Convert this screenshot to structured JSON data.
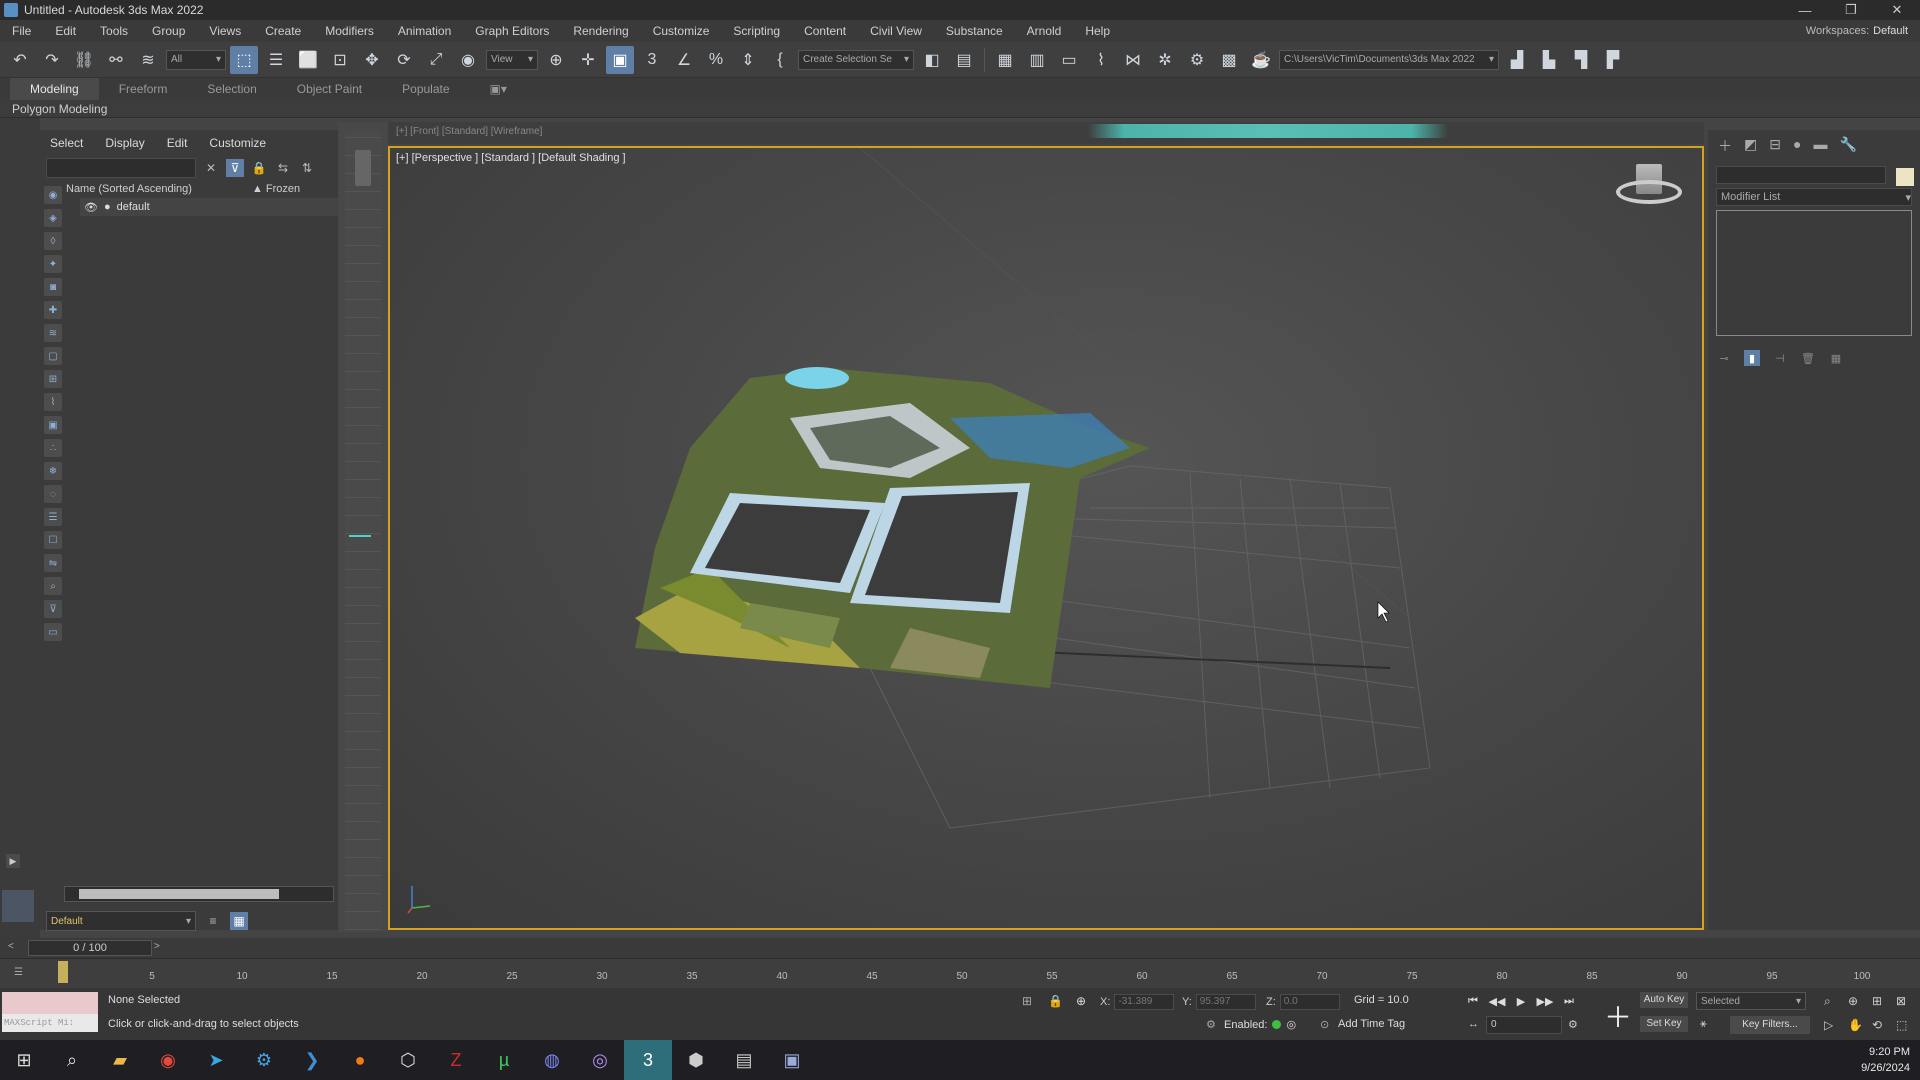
{
  "window": {
    "title": "Untitled - Autodesk 3ds Max 2022"
  },
  "menu": [
    "File",
    "Edit",
    "Tools",
    "Group",
    "Views",
    "Create",
    "Modifiers",
    "Animation",
    "Graph Editors",
    "Rendering",
    "Customize",
    "Scripting",
    "Content",
    "Civil View",
    "Substance",
    "Arnold",
    "Help"
  ],
  "workspace": {
    "label": "Workspaces:",
    "value": "Default"
  },
  "toolbar": {
    "filter_value": "All",
    "refcoord_value": "View",
    "selection_set": "Create Selection Se",
    "project_path": "C:\\Users\\VicTim\\Documents\\3ds Max 2022"
  },
  "ribbon": {
    "tabs": [
      "Modeling",
      "Freeform",
      "Selection",
      "Object Paint",
      "Populate"
    ],
    "sub_label": "Polygon Modeling"
  },
  "explorer": {
    "tabs": [
      "Select",
      "Display",
      "Edit",
      "Customize"
    ],
    "col_name": "Name (Sorted Ascending)",
    "col_frozen": "▲ Frozen",
    "rows": [
      {
        "name": "default"
      }
    ],
    "layer": "Default"
  },
  "viewport": {
    "label": "[+] [Perspective ] [Standard ] [Default Shading ]",
    "topstrip_label": "[+] [Front] [Standard] [Wireframe]"
  },
  "command_panel": {
    "modifier_list": "Modifier List"
  },
  "timeline": {
    "slider_text": "0 / 100",
    "ticks": [
      "5",
      "10",
      "15",
      "20",
      "25",
      "30",
      "35",
      "40",
      "45",
      "50",
      "55",
      "60",
      "65",
      "70",
      "75",
      "80",
      "85",
      "90",
      "95",
      "100"
    ]
  },
  "status": {
    "maxscript": "MAXScript Mi:",
    "selection": "None Selected",
    "prompt": "Click or click-and-drag to select objects",
    "x_label": "X:",
    "x_value": "-31.389",
    "y_label": "Y:",
    "y_value": "95.397",
    "z_label": "Z:",
    "z_value": "0.0",
    "grid": "Grid = 10.0",
    "enabled": "Enabled:",
    "add_time_tag": "Add Time Tag",
    "auto_key": "Auto Key",
    "set_key": "Set Key",
    "selected": "Selected",
    "key_filters": "Key Filters...",
    "frame": "0"
  },
  "taskbar": {
    "time": "9:20 PM",
    "date": "9/26/2024"
  },
  "colors": {
    "viewport_border": "#d6a21d",
    "active_tool": "#5f7fa6",
    "teal": "#4fd1c5"
  }
}
